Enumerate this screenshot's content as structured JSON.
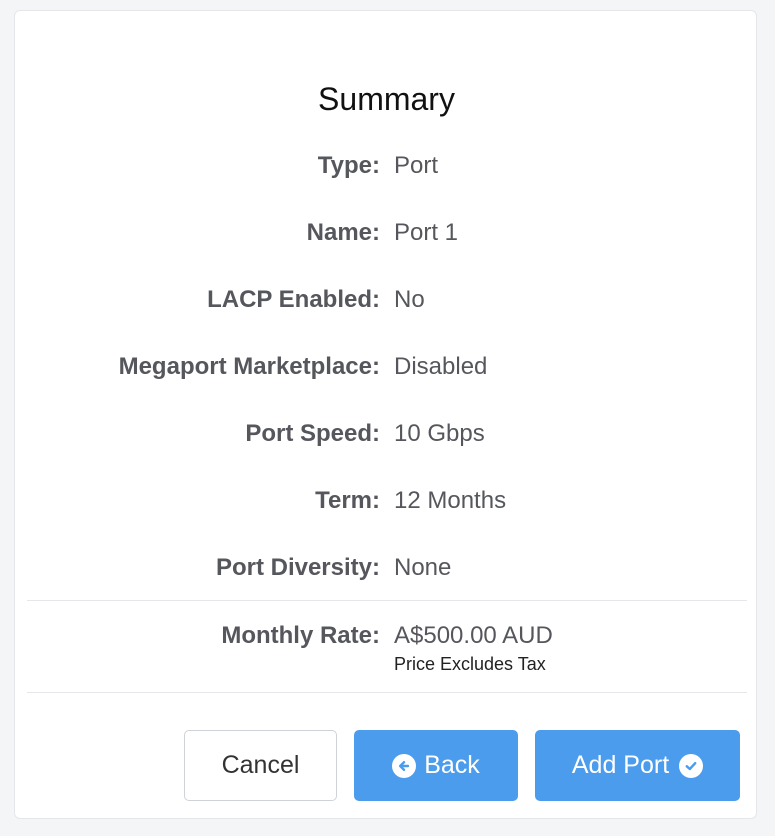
{
  "summary": {
    "title": "Summary",
    "rows": [
      {
        "label": "Type:",
        "value": "Port"
      },
      {
        "label": "Name:",
        "value": "Port 1"
      },
      {
        "label": "LACP Enabled:",
        "value": "No"
      },
      {
        "label": "Megaport Marketplace:",
        "value": "Disabled"
      },
      {
        "label": "Port Speed:",
        "value": "10 Gbps"
      },
      {
        "label": "Term:",
        "value": "12 Months"
      },
      {
        "label": "Port Diversity:",
        "value": "None"
      }
    ],
    "monthly_rate": {
      "label": "Monthly Rate:",
      "value": "A$500.00 AUD",
      "note": "Price Excludes Tax"
    }
  },
  "actions": {
    "cancel_label": "Cancel",
    "back_label": "Back",
    "back_icon": "arrow-left-circle-icon",
    "add_label": "Add Port",
    "add_icon": "check-circle-icon"
  },
  "colors": {
    "primary": "#4c9ced",
    "label_text": "#55575c"
  }
}
